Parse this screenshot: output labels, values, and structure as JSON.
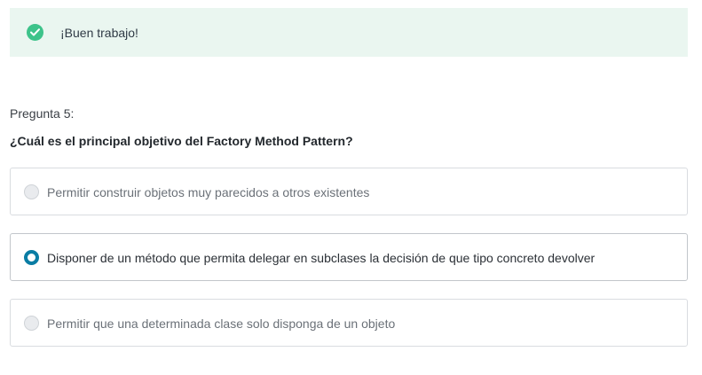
{
  "feedback": {
    "message": "¡Buen trabajo!",
    "icon": "check-circle-icon",
    "status_color": "#3dc38a",
    "background_color": "#eaf6f0"
  },
  "question": {
    "number_label": "Pregunta 5:",
    "text": "¿Cuál es el principal objetivo del Factory Method Pattern?"
  },
  "options": [
    {
      "label": "Permitir construir objetos muy parecidos a otros existentes",
      "selected": false
    },
    {
      "label": "Disponer de un método que permita delegar en subclases la decisión de que tipo concreto devolver",
      "selected": true
    },
    {
      "label": "Permitir que una determinada clase solo disponga de un objeto",
      "selected": false
    }
  ],
  "colors": {
    "accent": "#0a7da4"
  }
}
